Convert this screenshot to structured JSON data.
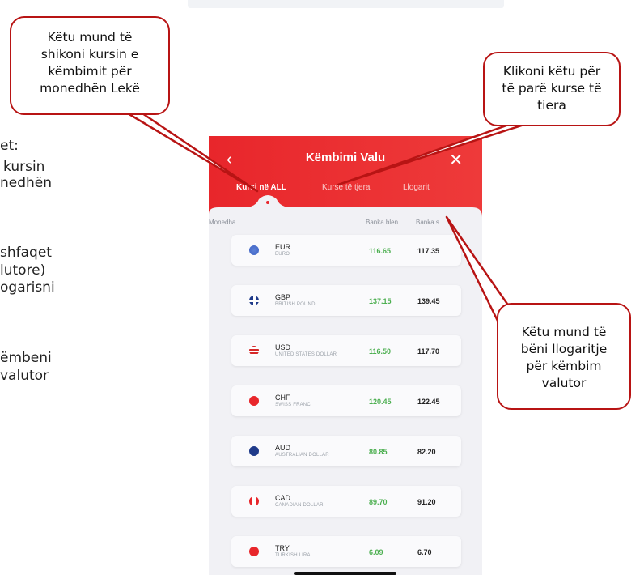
{
  "side_text": [
    "et:",
    "kursin",
    "nedhën",
    "shfaqet",
    "lutore)",
    "ogarisni",
    "ëmbeni",
    "valutor"
  ],
  "callouts": {
    "top_left": [
      "Këtu mund të",
      "shikoni kursin e",
      "këmbimit për",
      "monedhën Lekë"
    ],
    "top_right": [
      "Klikoni këtu për",
      "të parë kurse të",
      "tiera"
    ],
    "right": [
      "Këtu mund të",
      "bëni llogaritje",
      "për këmbim",
      "valutor"
    ]
  },
  "app": {
    "back_icon": "‹",
    "close_icon": "✕",
    "title": "Këmbimi Valu",
    "tabs": [
      {
        "label": "Kursi në ALL",
        "active": true
      },
      {
        "label": "Kurse të tjera",
        "active": false
      },
      {
        "label": "Llogarit",
        "active": false
      }
    ],
    "columns": {
      "currency": "Monedha",
      "buy": "Banka blen",
      "sell": "Banka s"
    },
    "rows": [
      {
        "code": "EUR",
        "name": "EURO",
        "buy": "116.65",
        "sell": "117.35",
        "flag": "eu"
      },
      {
        "code": "GBP",
        "name": "BRITISH POUND",
        "buy": "137.15",
        "sell": "139.45",
        "flag": "gb"
      },
      {
        "code": "USD",
        "name": "UNITED STATES DOLLAR",
        "buy": "116.50",
        "sell": "117.70",
        "flag": "us"
      },
      {
        "code": "CHF",
        "name": "SWISS FRANC",
        "buy": "120.45",
        "sell": "122.45",
        "flag": "ch"
      },
      {
        "code": "AUD",
        "name": "AUSTRALIAN DOLLAR",
        "buy": "80.85",
        "sell": "82.20",
        "flag": "au"
      },
      {
        "code": "CAD",
        "name": "CANADIAN DOLLAR",
        "buy": "89.70",
        "sell": "91.20",
        "flag": "ca"
      },
      {
        "code": "TRY",
        "name": "TURKISH LIRA",
        "buy": "6.09",
        "sell": "6.70",
        "flag": "tr"
      }
    ]
  },
  "colors": {
    "brand_red": "#e8262b",
    "callout_border": "#b81414",
    "buy_green": "#4caf50"
  }
}
